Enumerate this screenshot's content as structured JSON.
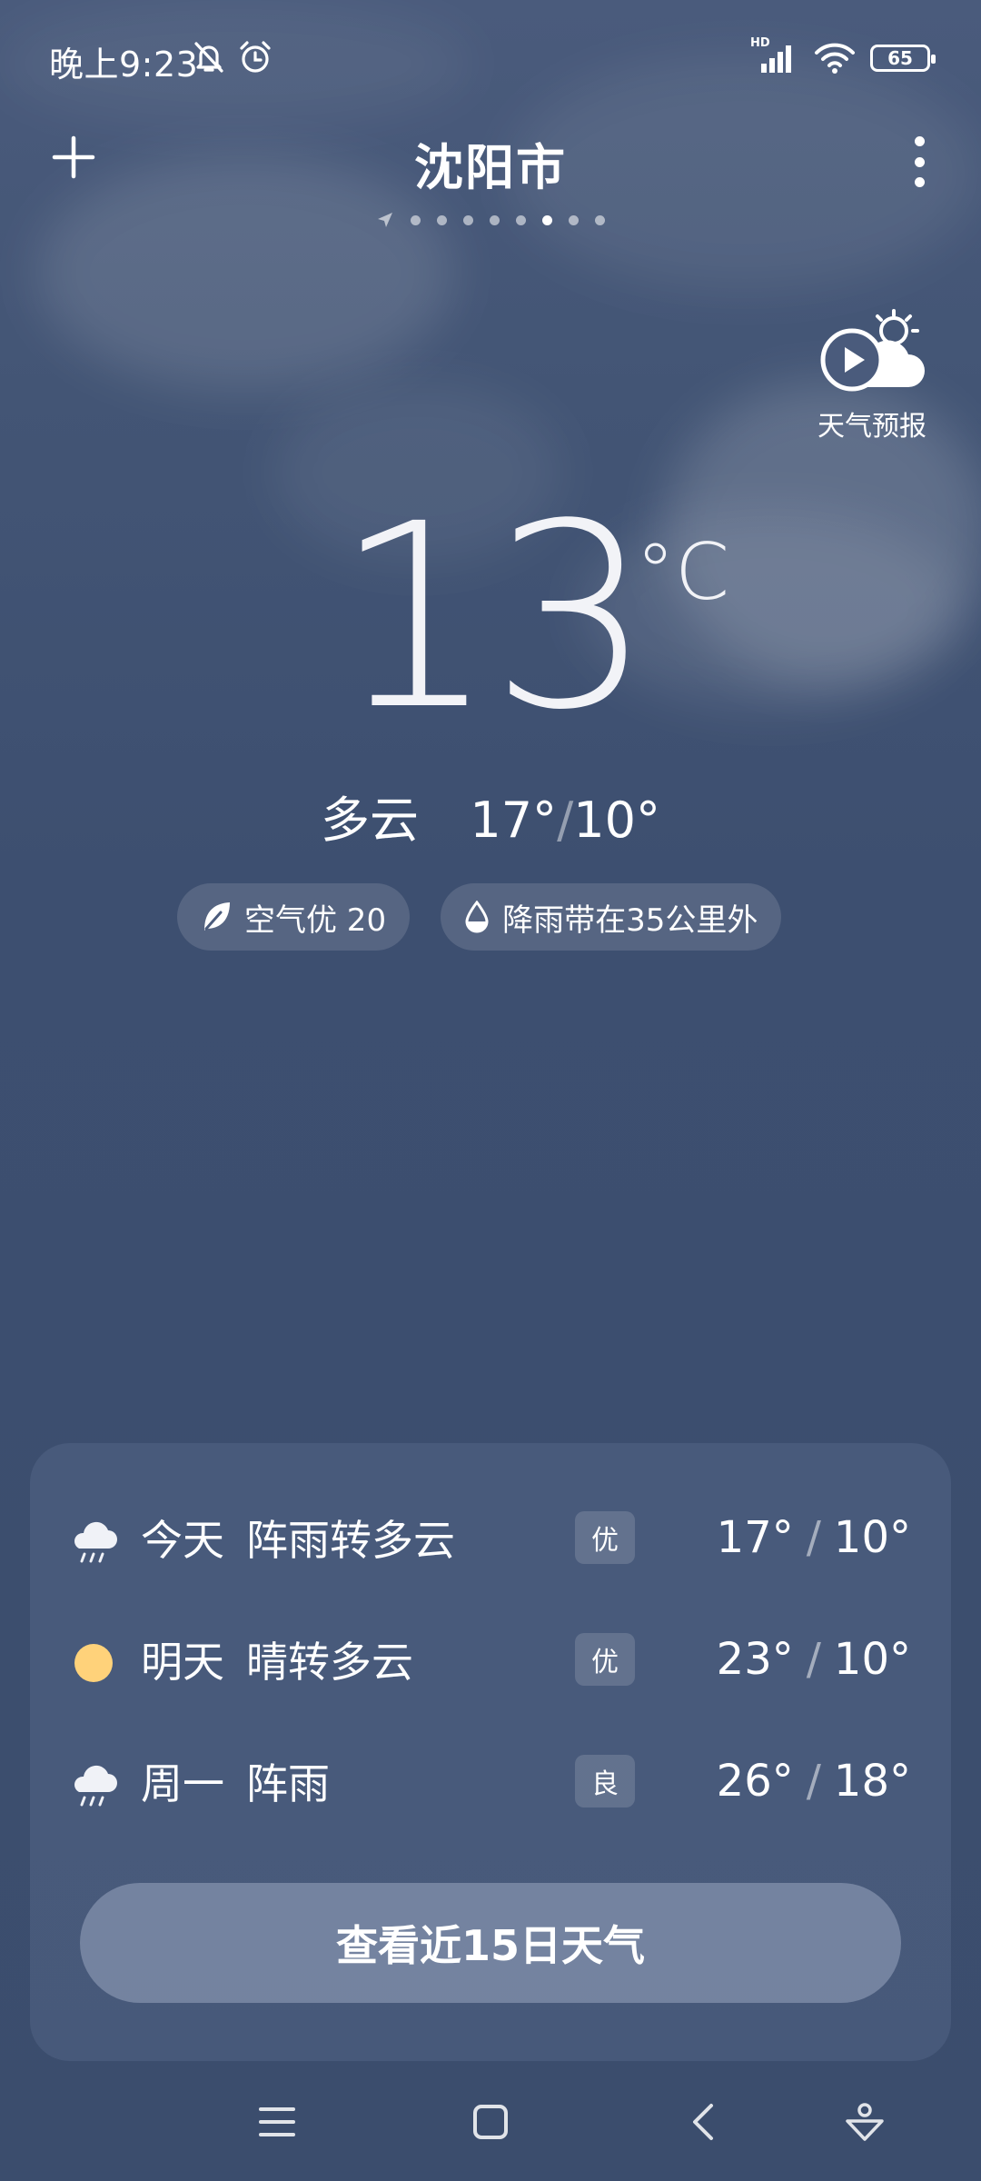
{
  "status_bar": {
    "time": "晚上9:23",
    "icons": [
      "bell-off-icon",
      "alarm-icon",
      "hd-signal-icon",
      "wifi-icon",
      "battery-icon"
    ],
    "battery": "65"
  },
  "header": {
    "city": "沈阳市",
    "page_count": 8,
    "active_page": 6
  },
  "forecast_video": {
    "label": "天气预报"
  },
  "current": {
    "temperature": "13",
    "unit": "°C",
    "condition": "多云",
    "high": "17°",
    "separator": "/",
    "low": "10°"
  },
  "pills": [
    {
      "icon": "leaf-icon",
      "label": "空气优 20"
    },
    {
      "icon": "raindrop-icon",
      "label": "降雨带在35公里外"
    }
  ],
  "forecast": [
    {
      "icon": "rain-cloud-icon",
      "day": "今天",
      "desc": "阵雨转多云",
      "aqi": "优",
      "high": "17°",
      "low": "10°"
    },
    {
      "icon": "sun-icon",
      "day": "明天",
      "desc": "晴转多云",
      "aqi": "优",
      "high": "23°",
      "low": "10°"
    },
    {
      "icon": "rain-cloud-icon",
      "day": "周一",
      "desc": "阵雨",
      "aqi": "良",
      "high": "26°",
      "low": "18°"
    }
  ],
  "cta_label": "查看近15日天气",
  "colors": {
    "background": "#3c4e6e",
    "sun": "#ffd27a"
  }
}
